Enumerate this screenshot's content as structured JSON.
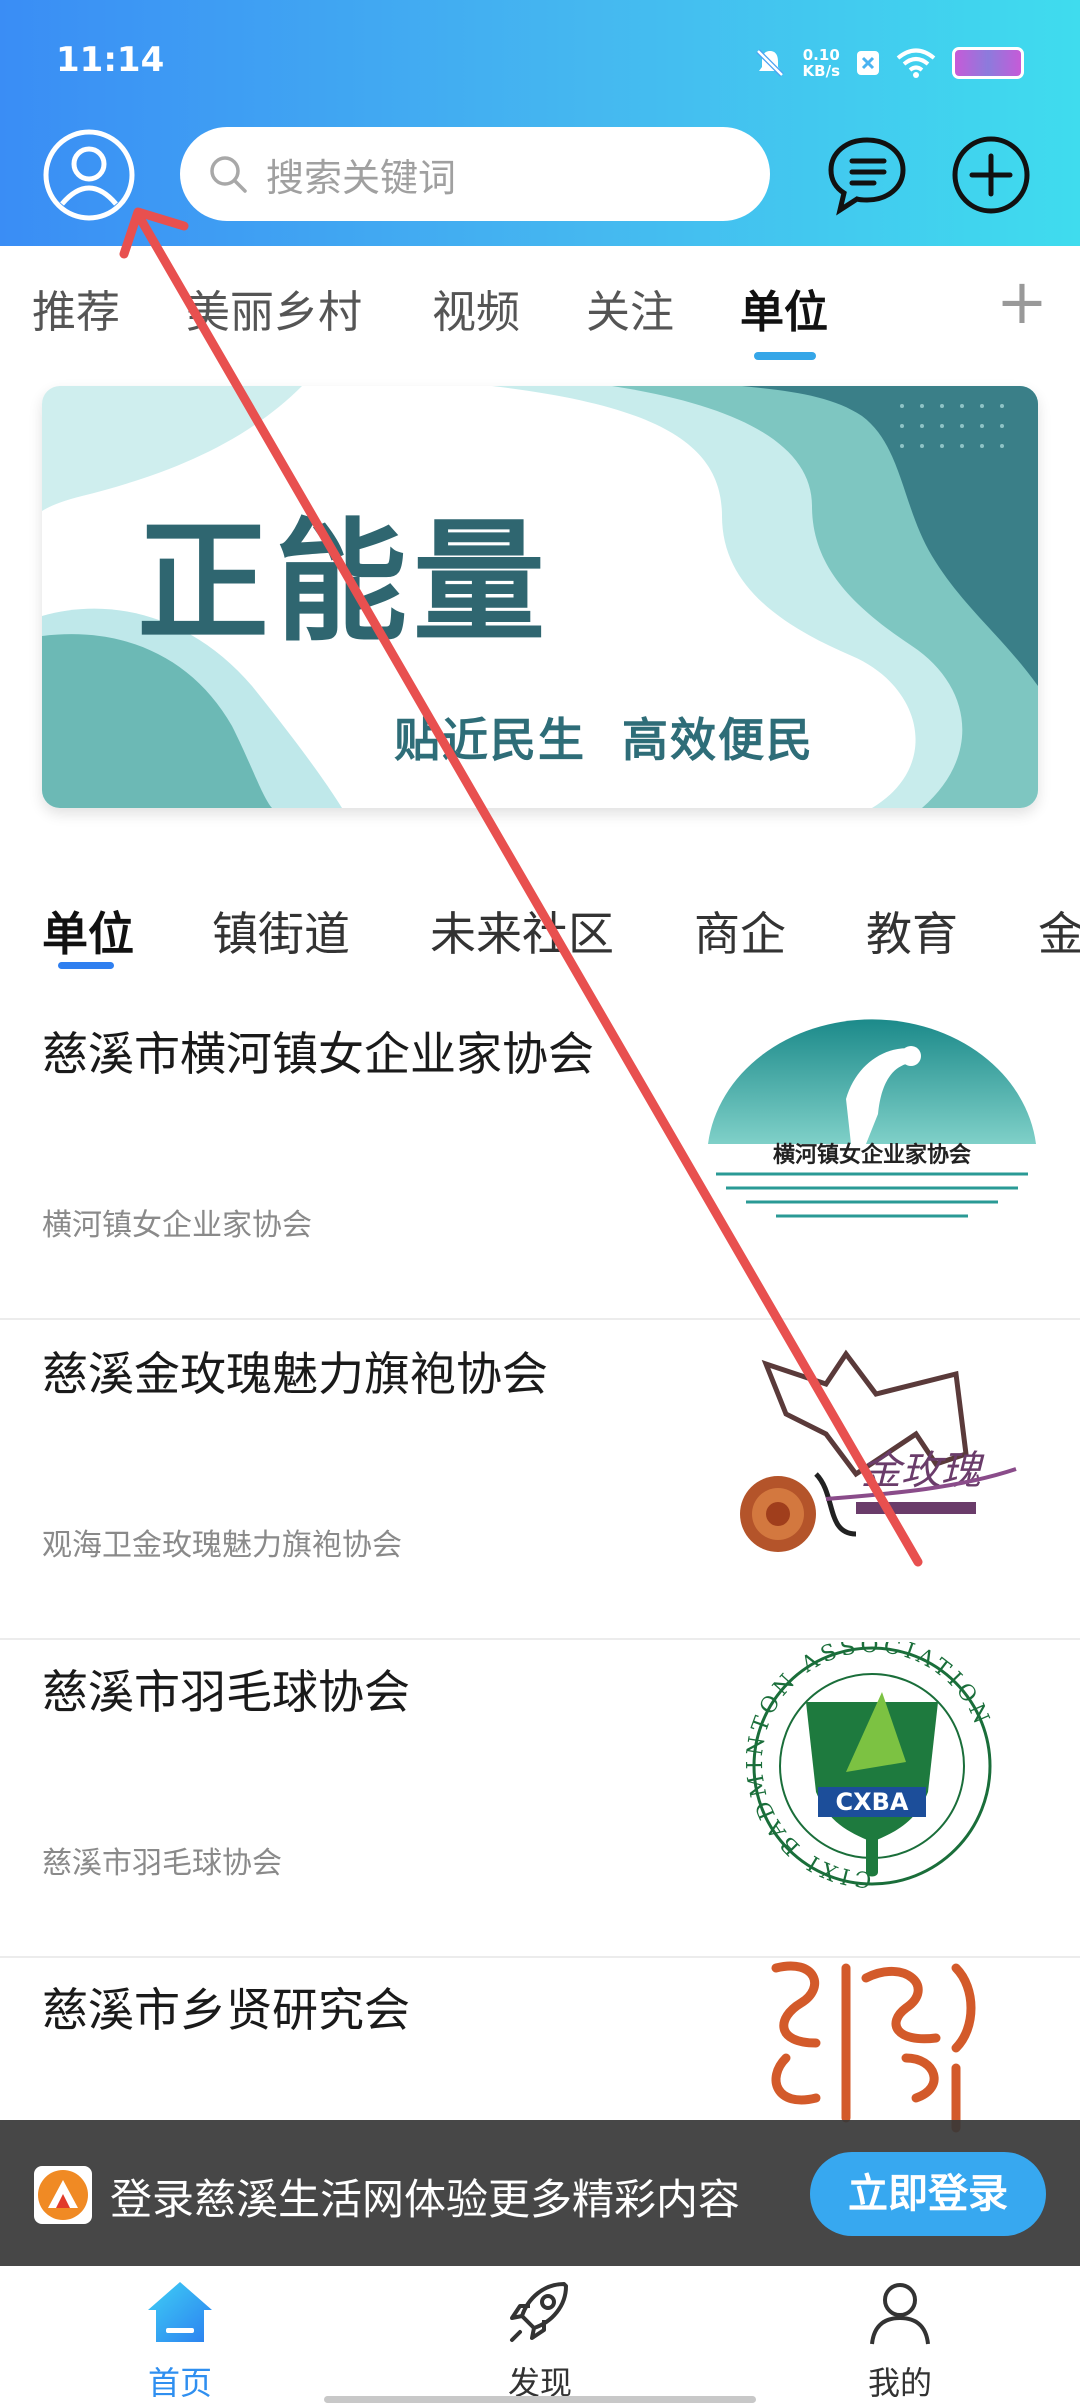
{
  "status_bar": {
    "time": "11:14",
    "net_speed_value": "0.10",
    "net_speed_unit": "KB/s",
    "icons": [
      "mute-icon",
      "data-icon",
      "wifi-icon",
      "battery-icon"
    ]
  },
  "header": {
    "search_placeholder": "搜索关键词",
    "icons": [
      "avatar-icon",
      "search-icon",
      "message-icon",
      "add-icon"
    ]
  },
  "top_tabs": [
    {
      "label": "推荐"
    },
    {
      "label": "美丽乡村"
    },
    {
      "label": "视频"
    },
    {
      "label": "关注"
    },
    {
      "label": "单位",
      "active": true
    }
  ],
  "top_tabs_more": "+",
  "banner": {
    "title": "正能量",
    "subtitle": "贴近民生  高效便民"
  },
  "category_tabs": [
    {
      "label": "单位",
      "active": true
    },
    {
      "label": "镇街道"
    },
    {
      "label": "未来社区"
    },
    {
      "label": "商企"
    },
    {
      "label": "教育"
    },
    {
      "label": "金"
    }
  ],
  "list": [
    {
      "title": "慈溪市横河镇女企业家协会",
      "source": "横河镇女企业家协会",
      "thumb_text": "横河镇女企业家协会"
    },
    {
      "title": "慈溪金玫瑰魅力旗袍协会",
      "source": "观海卫金玫瑰魅力旗袍协会",
      "thumb_text": "金玫瑰"
    },
    {
      "title": "慈溪市羽毛球协会",
      "source": "慈溪市羽毛球协会",
      "thumb_text": "CXBA",
      "thumb_ring": "CIXI BADMINTON ASSOCIATION"
    },
    {
      "title": "慈溪市乡贤研究会",
      "source": "",
      "thumb_text": ""
    }
  ],
  "login_bar": {
    "text": "登录慈溪生活网体验更多精彩内容",
    "button": "立即登录"
  },
  "bottom_nav": [
    {
      "label": "首页",
      "icon": "home-icon",
      "active": true
    },
    {
      "label": "发现",
      "icon": "rocket-icon"
    },
    {
      "label": "我的",
      "icon": "person-icon"
    }
  ],
  "colors": {
    "accent": "#2f8ff0",
    "header_start": "#3a8df5",
    "header_end": "#3fdcee",
    "annotation": "#e8504f"
  }
}
